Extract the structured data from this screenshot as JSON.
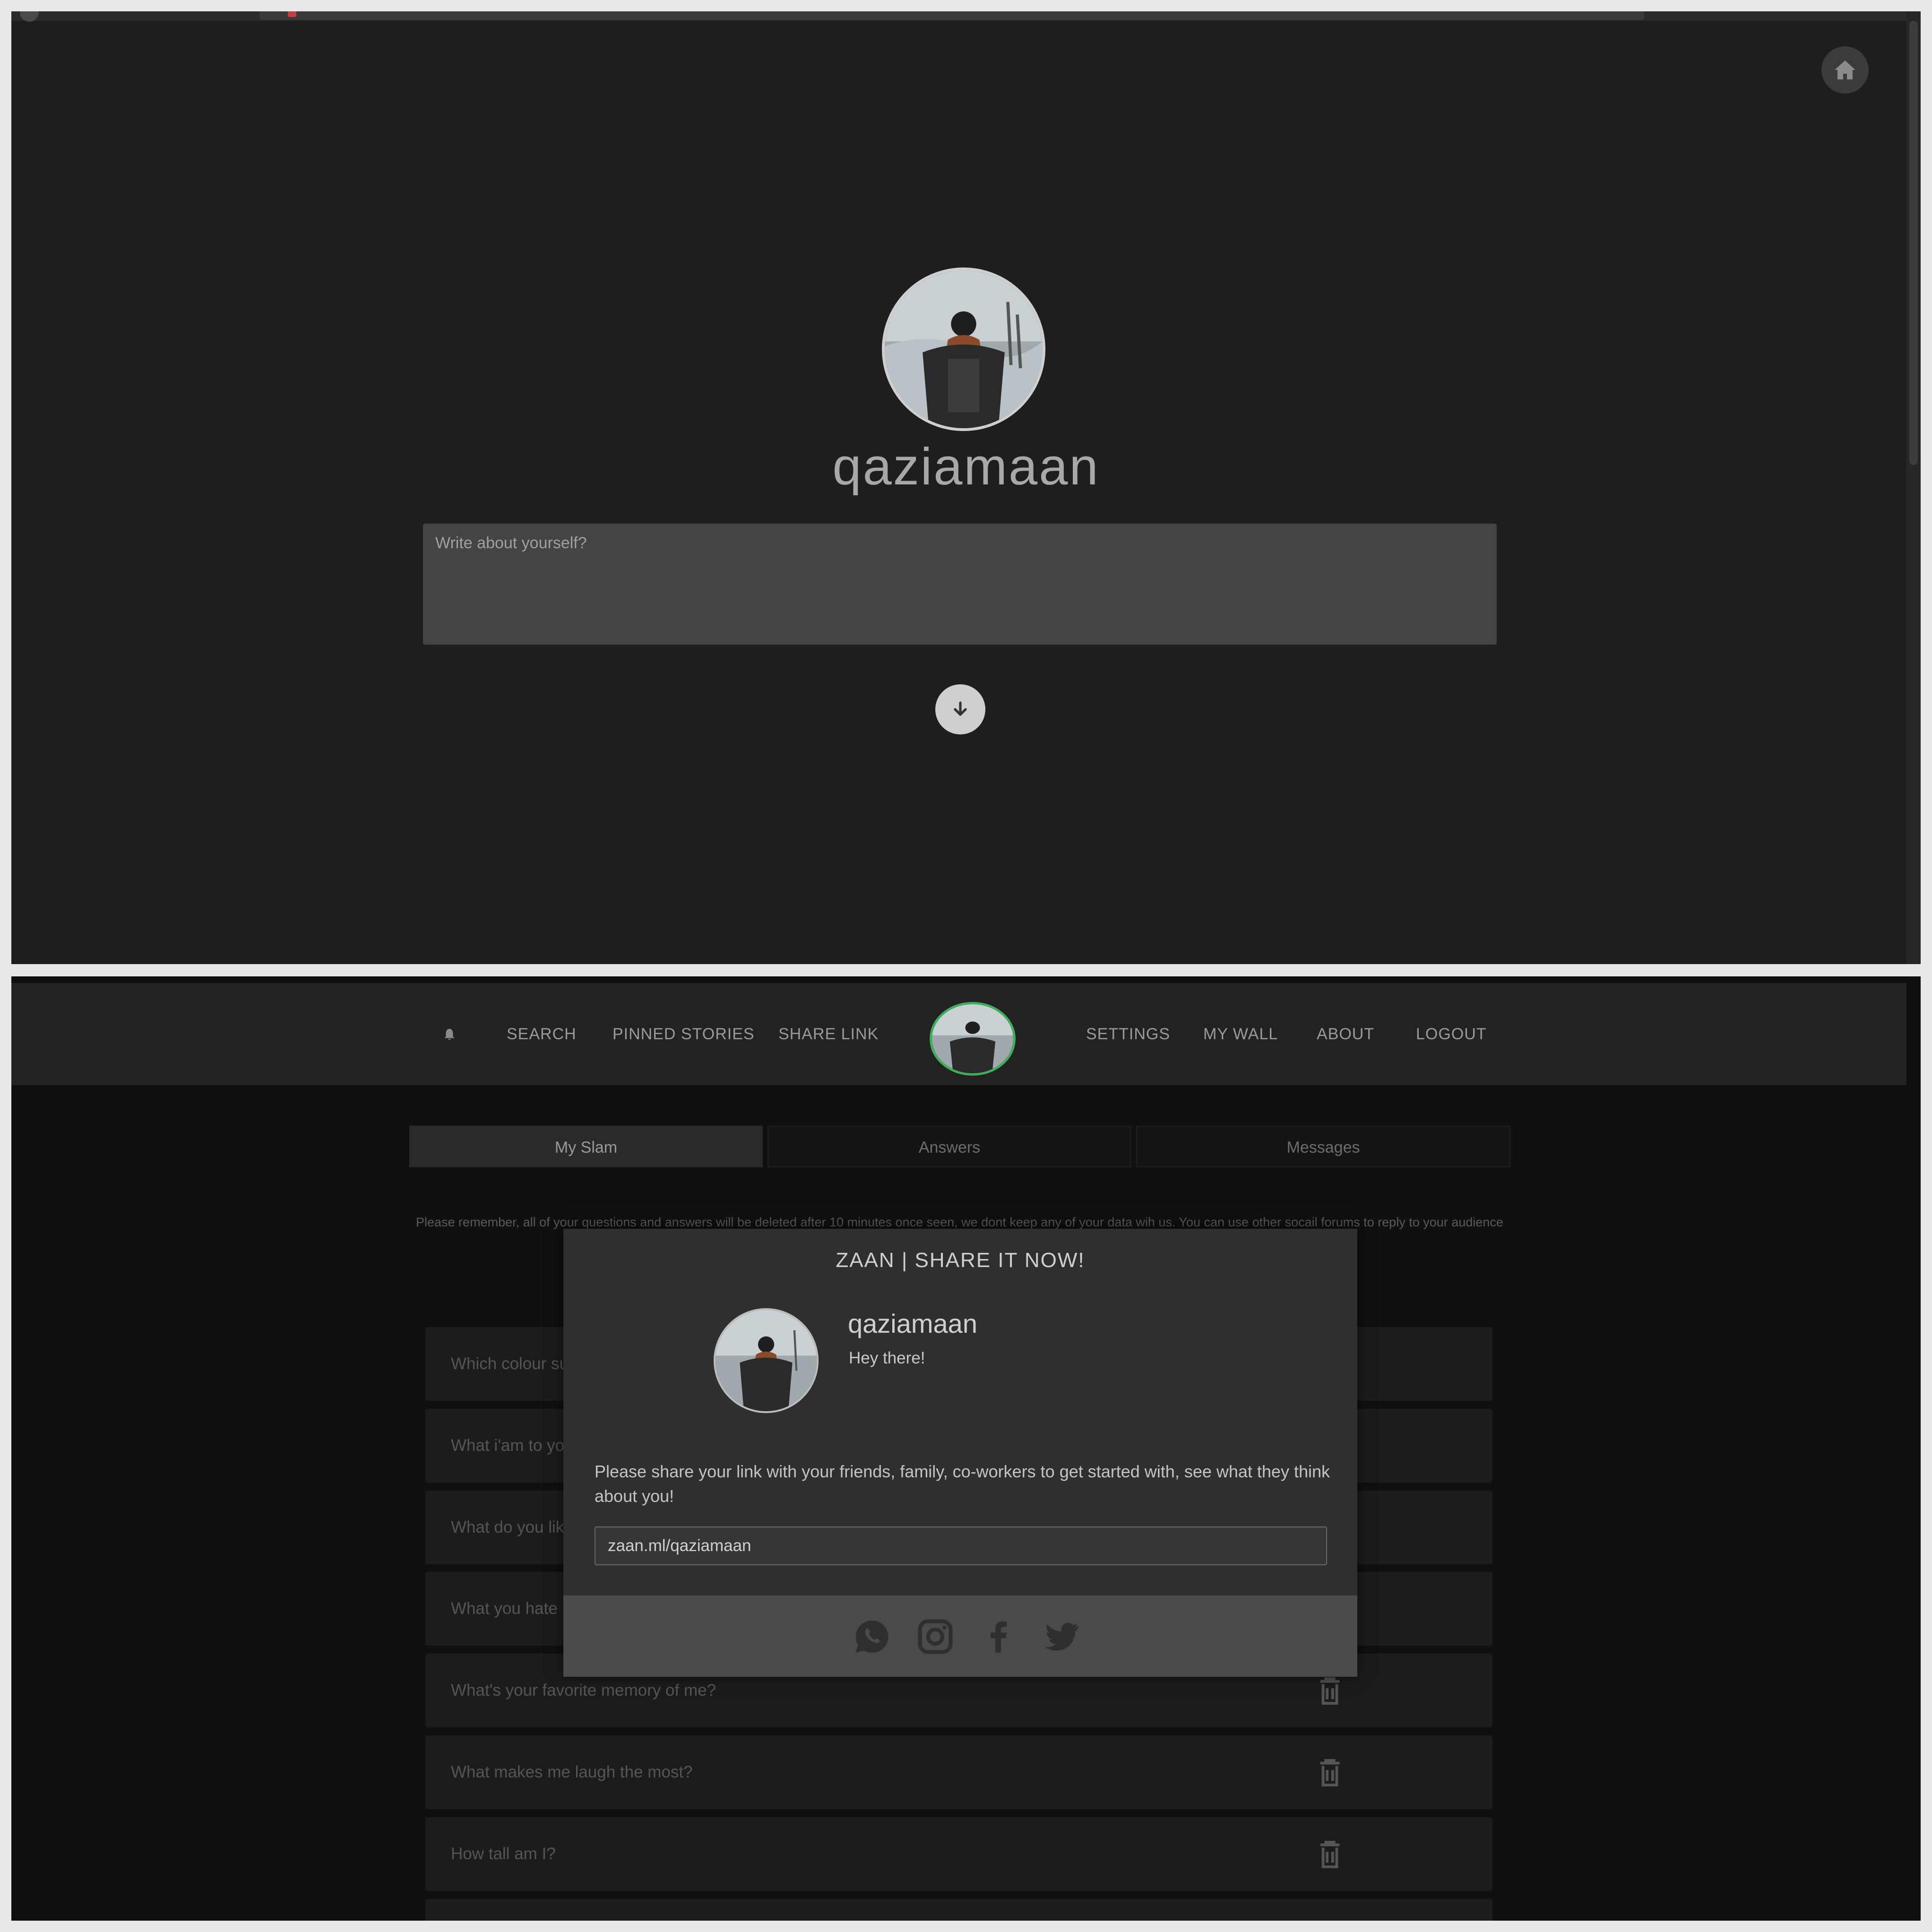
{
  "settings_page": {
    "username": "qaziamaan",
    "about_placeholder": "Write about yourself?"
  },
  "app_page": {
    "nav": {
      "search": "SEARCH",
      "pinned_stories": "PINNED STORIES",
      "share_link": "SHARE LINK",
      "settings": "SETTINGS",
      "my_wall": "MY WALL",
      "about": "ABOUT",
      "logout": "LOGOUT"
    },
    "tabs": [
      "My Slam",
      "Answers",
      "Messages"
    ],
    "notice": "Please remember, all of your questions and answers will be deleted after 10 minutes once seen, we dont keep any of your data wih us. You can use other socail forums to reply to your audience",
    "questions": [
      "Which colour su",
      "What i'am to yo",
      "What do you lik",
      "What you hate",
      "What's your favorite memory of me?",
      "What makes me laugh the most?",
      "How tall am I?"
    ]
  },
  "share_modal": {
    "title": "ZAAN | SHARE IT NOW!",
    "username": "qaziamaan",
    "bio": "Hey there!",
    "message": "Please share your link with your friends, family, co-workers to get started with, see what they think about you!",
    "link": "zaan.ml/qaziamaan",
    "share_icons": [
      "whatsapp-icon",
      "instagram-icon",
      "facebook-icon",
      "twitter-icon"
    ]
  },
  "colors": {
    "accent_green": "#3fae5a",
    "background_dark": "#1e1e1e",
    "modal_background": "#2f2f2f"
  }
}
